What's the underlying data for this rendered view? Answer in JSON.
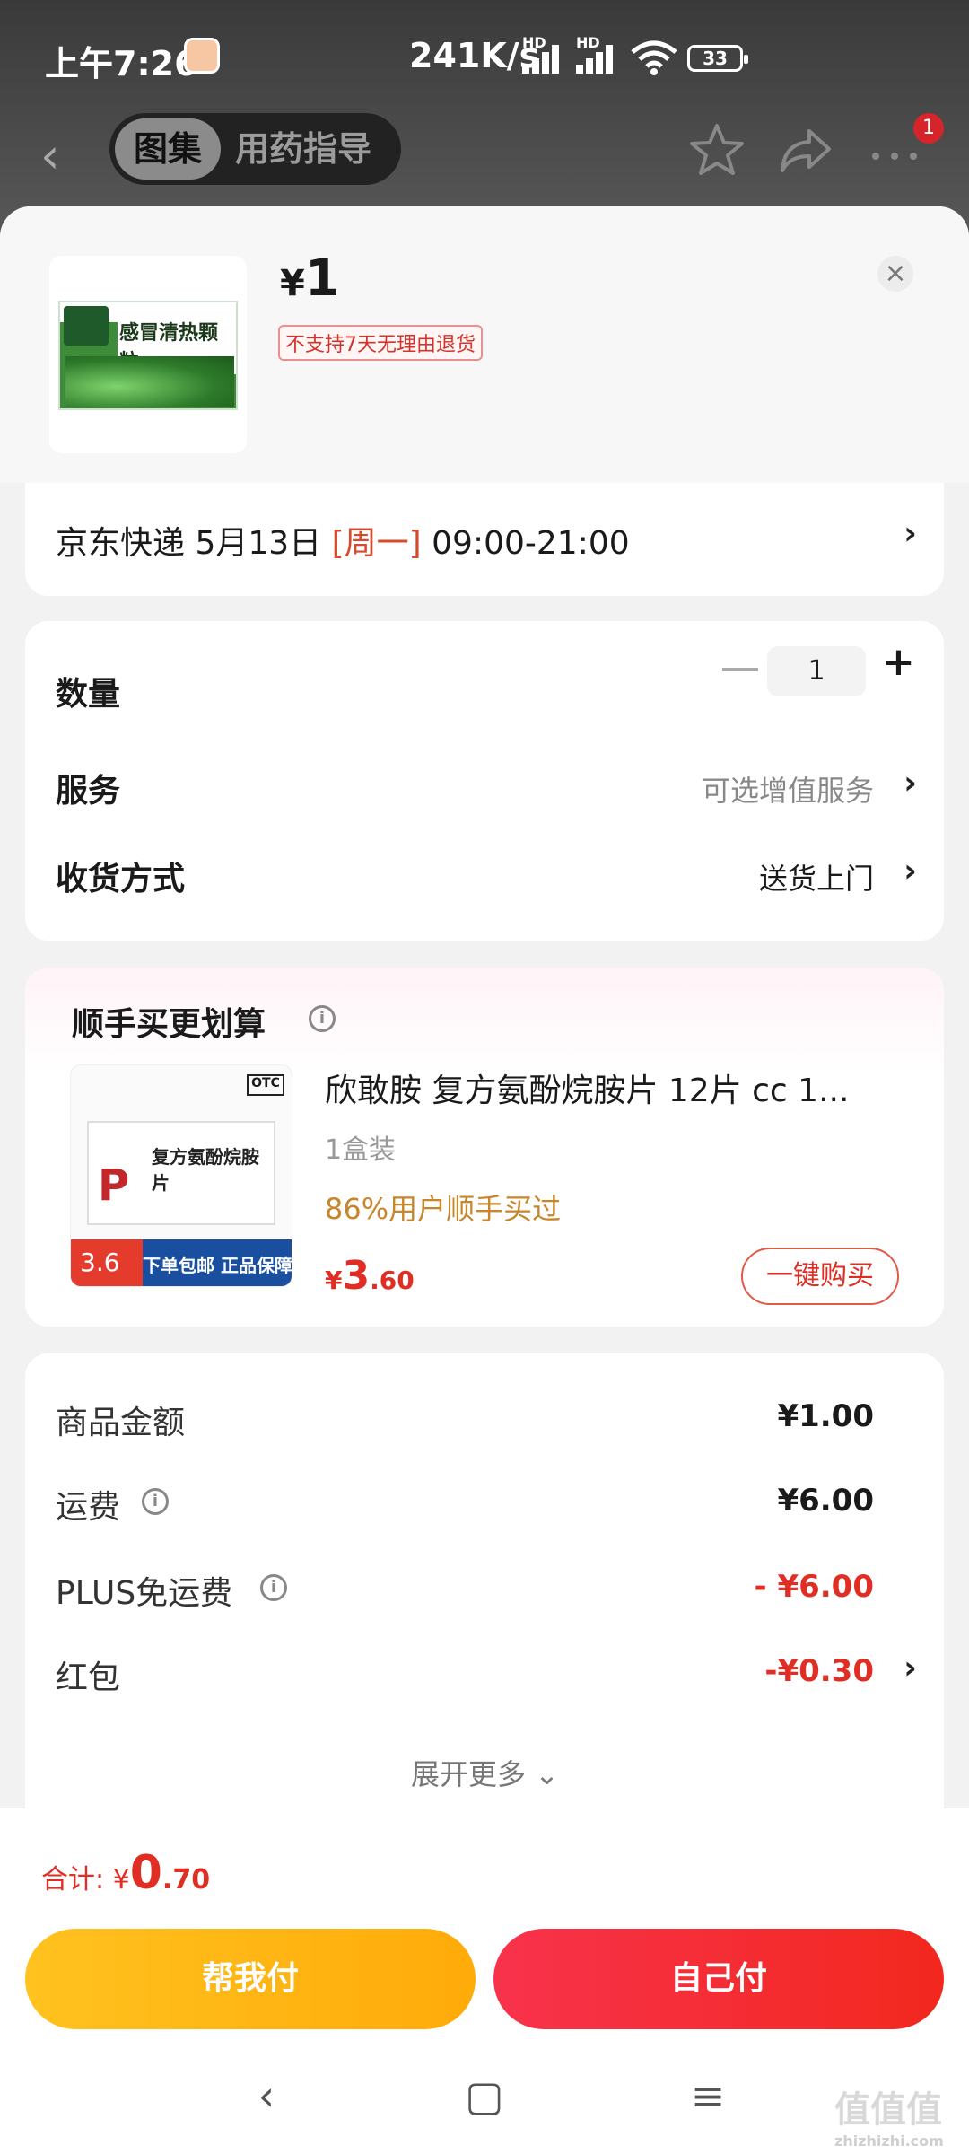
{
  "status_bar": {
    "time": "上午7:26",
    "net_speed": "241K/s",
    "hd1": "HD",
    "hd2": "HD",
    "battery": "33"
  },
  "nav": {
    "tab_active": "图集",
    "tab_inactive": "用药指导",
    "badge_count": "1"
  },
  "product": {
    "price_symbol": "¥",
    "price": "1",
    "tag": "不支持7天无理由退货",
    "box_label": "感冒清热颗粒"
  },
  "shipping": {
    "carrier": "京东快递 5月13日 ",
    "weekday": "[周一]",
    "window": " 09:00-21:00"
  },
  "options": {
    "qty_label": "数量",
    "qty_value": "1",
    "service_label": "服务",
    "service_value": "可选增值服务",
    "delivery_label": "收货方式",
    "delivery_value": "送货上门"
  },
  "addon": {
    "title": "顺手买更划算",
    "name": "欣敢胺 复方氨酚烷胺片 12片 cc 1...",
    "spec": "1盒装",
    "users": "86%用户顺手买过",
    "price_symbol": "¥",
    "price_int": "3",
    "price_dec": ".60",
    "buy_label": "一键购买",
    "img_price": "3.6",
    "img_banner": "下单包邮 正品保障",
    "img_box_title": "复方氨酚烷胺片",
    "img_otc": "OTC"
  },
  "summary": {
    "goods_label": "商品金额",
    "goods_value": "¥1.00",
    "shipping_label": "运费",
    "shipping_value": "¥6.00",
    "plus_label": "PLUS免运费",
    "plus_value": "- ¥6.00",
    "redpack_label": "红包",
    "redpack_value": "-¥0.30",
    "expand_label": "展开更多 ⌄"
  },
  "bottom": {
    "total_label": "合计: ¥",
    "total_int": "0",
    "total_dec": ".70",
    "help_pay": "帮我付",
    "self_pay": "自己付"
  },
  "watermark": {
    "text": "值值值",
    "sub": "zhizhizhi.com"
  },
  "colors": {
    "accent_red": "#e02e24",
    "accent_yellow": "#ffb516",
    "text_gold": "#c8862a"
  }
}
